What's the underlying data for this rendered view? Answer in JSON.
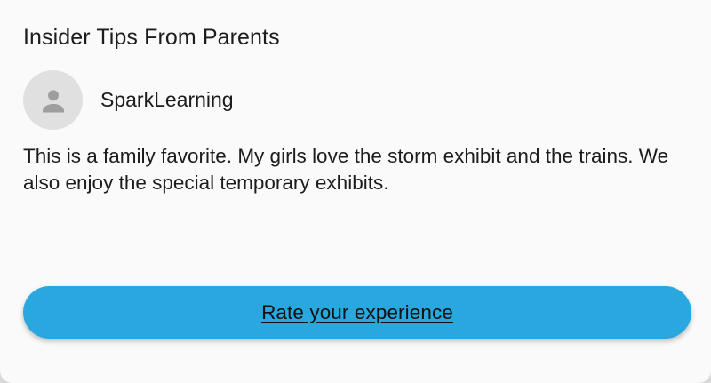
{
  "section": {
    "title": "Insider Tips From Parents"
  },
  "review": {
    "author": "SparkLearning",
    "avatar_icon": "person-icon",
    "text": "This is a family favorite. My girls love the storm exhibit and the trains. We also enjoy the special temporary exhibits."
  },
  "actions": {
    "rate_label": "Rate your experience"
  },
  "colors": {
    "accent": "#29a8df",
    "card_background": "#fafafa",
    "avatar_background": "#e0e0e0",
    "avatar_icon": "#9e9e9e"
  }
}
